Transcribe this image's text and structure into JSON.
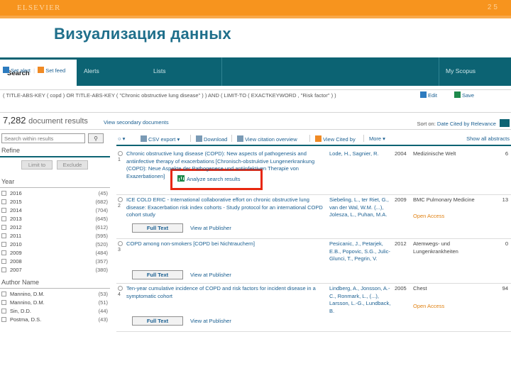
{
  "slide": {
    "brand": "ELSEVIER",
    "page_number": "25",
    "title": "Визуализация данных",
    "accent_orange": "#f7941e",
    "title_color": "#1f6f8b"
  },
  "scopus": {
    "nav": {
      "search_tab": "Search",
      "items": [
        "Alerts",
        "Lists"
      ],
      "my_scopus": "My Scopus",
      "bar_color": "#0c6373"
    },
    "query": {
      "text": "( TITLE-ABS-KEY ( copd )  OR  TITLE-ABS-KEY ( \"Chronic obstructive lung disease\" ) )  AND  ( LIMIT-TO ( EXACTKEYWORD ,  \"Risk factor\" ) )",
      "edit_label": "Edit",
      "save_label": "Save",
      "set_alert_label": "Set alert",
      "set_feed_label": "Set feed"
    },
    "results_header": {
      "count": "7,282",
      "count_label": "document results",
      "view_secondary": "View secondary documents",
      "analyze": "Analyze search results",
      "analyze_highlight_color": "#e8270f",
      "sort_label": "Sort on:",
      "sort_options": [
        "Date",
        "Cited by",
        "Relevance"
      ]
    },
    "refine": {
      "search_within_placeholder": "Search within results",
      "search_icon": "search-icon",
      "title": "Refine",
      "limit_to": "Limit to",
      "exclude": "Exclude",
      "facets": [
        {
          "name": "Year",
          "rows": [
            {
              "label": "2016",
              "count": "(45)"
            },
            {
              "label": "2015",
              "count": "(682)"
            },
            {
              "label": "2014",
              "count": "(704)"
            },
            {
              "label": "2013",
              "count": "(645)"
            },
            {
              "label": "2012",
              "count": "(612)"
            },
            {
              "label": "2011",
              "count": "(595)"
            },
            {
              "label": "2010",
              "count": "(520)"
            },
            {
              "label": "2009",
              "count": "(484)"
            },
            {
              "label": "2008",
              "count": "(357)"
            },
            {
              "label": "2007",
              "count": "(380)"
            }
          ]
        },
        {
          "name": "Author Name",
          "rows": [
            {
              "label": "Mannino, D.M.",
              "count": "(53)"
            },
            {
              "label": "Mannino, D.M.",
              "count": "(51)"
            },
            {
              "label": "Sin, D.D.",
              "count": "(44)"
            },
            {
              "label": "Postma, D.S.",
              "count": "(43)"
            }
          ]
        }
      ]
    },
    "toolbar": {
      "select_all": "",
      "csv_export": "CSV export",
      "download": "Download",
      "view_citation_overview": "View citation overview",
      "view_cited_by": "View Cited by",
      "more": "More",
      "show_all_abstracts": "Show all abstracts"
    },
    "rows": [
      {
        "index": "1",
        "title": "Chronic obstructive lung disease (COPD): New aspects of pathogenesis and antiinfective therapy of exacerbations [Chronisch-obstruktive Lungenerkrankung (COPD): Neue Aspekte der Pathogenese und antiinfektiven Therapie von Exazerbationen]",
        "authors": "Lode, H., Sagnier, R.",
        "year": "2004",
        "source": "Medizinische Welt",
        "cites": "6",
        "open_access": "",
        "full_text": "",
        "view_at_publisher": ""
      },
      {
        "index": "2",
        "title": "ICE COLD ERIC - International collaborative effort on chronic obstructive lung disease: Exacerbation risk index cohorts - Study protocol for an international COPD cohort study",
        "authors": "Siebeling, L., ter Riet, G., van der Wal, W.M. (...), Jolesza, L., Puhan, M.A.",
        "year": "2009",
        "source": "BMC Pulmonary Medicine",
        "cites": "13",
        "open_access": "Open Access",
        "full_text": "Full Text",
        "view_at_publisher": "View at Publisher"
      },
      {
        "index": "3",
        "title": "COPD among non-smokers  [COPD bei Nichtrauchern]",
        "authors": "Pesicanic, J., Petarjek, E.B., Popovic, S.G., Julic-Glunci, T., Pegrin, V.",
        "year": "2012",
        "source": "Atemwegs- und Lungenkrankheiten",
        "cites": "0",
        "open_access": "",
        "full_text": "Full Text",
        "view_at_publisher": "View at Publisher"
      },
      {
        "index": "4",
        "title": "Ten-year cumulative incidence of COPD and risk factors for incident disease in a symptomatic cohort",
        "authors": "Lindberg, A., Jonsson, A.-C., Ronmark, L., (...), Larsson, L.-G., Lundback, B.",
        "year": "2005",
        "source": "Chest",
        "cites": "94",
        "open_access": "Open Access",
        "full_text": "Full Text",
        "view_at_publisher": "View at Publisher"
      }
    ]
  }
}
